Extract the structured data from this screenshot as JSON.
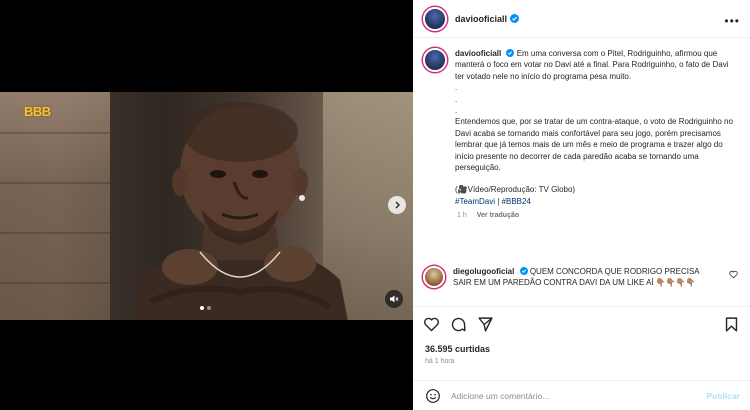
{
  "post": {
    "username": "daviooficiall",
    "more_label": "•••"
  },
  "media": {
    "channel_logo": "BBB",
    "slide_count": 2,
    "active_slide": 1
  },
  "caption": {
    "username": "daviooficiall",
    "lines": [
      "Em uma conversa com o Pitel, Rodriguinho, afirmou que manterá o foco em votar no Davi até a final. Para Rodriguinho, o fato de Davi ter votado nele no início do programa pesa muito.",
      ".",
      ".",
      ".",
      "Entendemos que, por se tratar de um contra-ataque, o voto de Rodriguinho no Davi acaba se tornando mais confortável para seu jogo, porém precisamos lembrar que já temos mais de um mês e meio de programa e trazer algo do início presente no decorrer de cada paredão acaba se tornando uma perseguição.",
      "",
      "(🎥Vídeo/Reprodução: TV Globo)"
    ],
    "hashtags": [
      "#TeamDavi",
      "|",
      "#BBB24"
    ],
    "time": "1 h",
    "translate_label": "Ver tradução"
  },
  "comment": {
    "username": "diegolugooficial",
    "text": "QUEM CONCORDA QUE RODRIGO PRECISA SAIR EM UM PAREDÃO CONTRA DAVI DA UM LIKE AÍ 👇🏽👇🏽👇🏽👇🏽"
  },
  "stats": {
    "likes": "36.595 curtidas",
    "posted_ago": "há 1 hora"
  },
  "composer": {
    "placeholder": "Adicione um comentário...",
    "publish_label": "Publicar"
  },
  "colors": {
    "verified": "#0095f6",
    "link": "#00376b",
    "muted": "#8e8e8e",
    "publish_disabled": "#b2dffc"
  },
  "icons": [
    "verified-badge-icon",
    "chevron-right-icon",
    "volume-muted-icon",
    "heart-icon",
    "comment-icon",
    "share-icon",
    "bookmark-icon",
    "emoji-icon"
  ]
}
